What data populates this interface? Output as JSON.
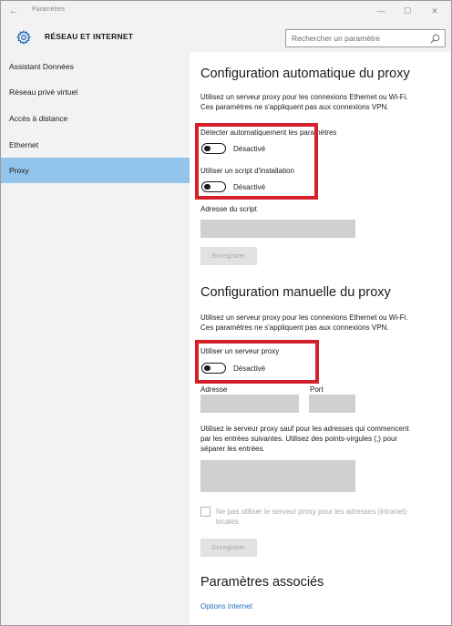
{
  "window": {
    "title": "Paramètres",
    "back_glyph": "←",
    "minimize_glyph": "—",
    "maximize_glyph": "☐",
    "close_glyph": "✕"
  },
  "header": {
    "title": "RÉSEAU ET INTERNET",
    "icon": "gear-icon"
  },
  "search": {
    "placeholder": "Rechercher un paramètre",
    "icon": "search-icon"
  },
  "sidebar": {
    "items": [
      {
        "label": "Assistant Données",
        "selected": false
      },
      {
        "label": "Réseau privé virtuel",
        "selected": false
      },
      {
        "label": "Accès à distance",
        "selected": false
      },
      {
        "label": "Ethernet",
        "selected": false
      },
      {
        "label": "Proxy",
        "selected": true
      }
    ]
  },
  "auto_proxy": {
    "heading": "Configuration automatique du proxy",
    "description_line1": "Utilisez un serveur proxy pour les connexions Ethernet ou Wi-Fi.",
    "description_line2": "Ces paramètres ne s'appliquent pas aux connexions VPN.",
    "detect_label": "Détecter automatiquement les paramètres",
    "detect_state": "Désactivé",
    "script_label": "Utiliser un script d'installation",
    "script_state": "Désactivé",
    "script_address_label": "Adresse du script",
    "save_label": "Enregistrer"
  },
  "manual_proxy": {
    "heading": "Configuration manuelle du proxy",
    "description_line1": "Utilisez un serveur proxy pour les connexions Ethernet ou Wi-Fi.",
    "description_line2": "Ces paramètres ne s'appliquent pas aux connexions VPN.",
    "use_proxy_label": "Utiliser un serveur proxy",
    "use_proxy_state": "Désactivé",
    "address_label": "Adresse",
    "port_label": "Port",
    "exceptions_line1": "Utilisez le serveur proxy sauf pour les adresses qui commencent",
    "exceptions_line2": "par les entrées suivantes. Utilisez des points-virgules (;) pour",
    "exceptions_line3": "séparer les entrées.",
    "local_checkbox_line1": "Ne pas utiliser le serveur proxy pour les adresses (intranet)",
    "local_checkbox_line2": "locales",
    "save_label": "Enregistrer"
  },
  "related": {
    "heading": "Paramètres associés",
    "link": "Options Internet"
  },
  "colors": {
    "selected_item": "#93c5ec",
    "highlight_box": "#d4202a",
    "link": "#1f6db8",
    "chrome_bg": "#f2f2f2"
  }
}
